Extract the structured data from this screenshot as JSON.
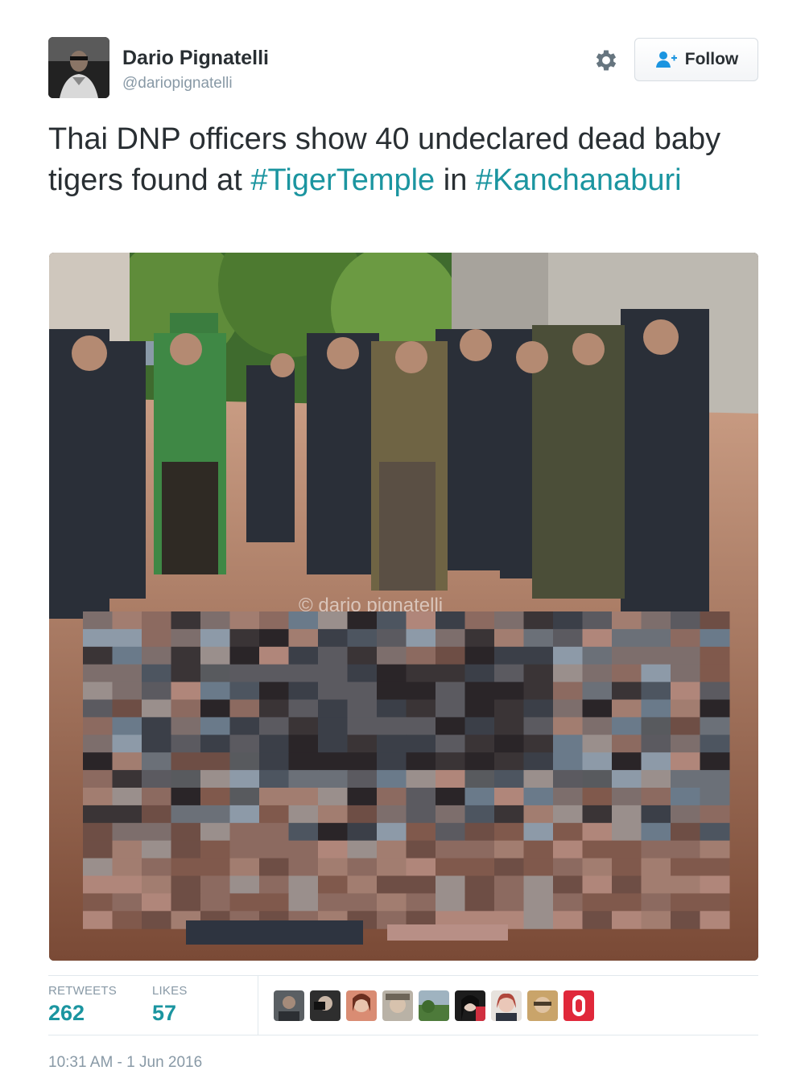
{
  "author": {
    "display_name": "Dario Pignatelli",
    "screen_name": "@dariopignatelli",
    "avatar_icon": "profile-photo"
  },
  "header": {
    "gear_icon": "gear-icon",
    "follow_label": "Follow",
    "follow_icon": "add-user-icon"
  },
  "tweet": {
    "text_before": "Thai DNP officers show 40 undeclared dead baby tigers found at ",
    "hashtag_1": "#TigerTemple",
    "text_middle": " in ",
    "hashtag_2": "#Kanchanaburi"
  },
  "photo": {
    "watermark": "© dario pignatelli"
  },
  "stats": {
    "retweets_label": "RETWEETS",
    "retweets_value": "262",
    "likes_label": "LIKES",
    "likes_value": "57"
  },
  "timestamp": "10:31 AM - 1 Jun 2016",
  "colors": {
    "link": "#1b95a0",
    "text": "#292f33",
    "muted": "#8899a6",
    "border": "#e1e8ed"
  }
}
